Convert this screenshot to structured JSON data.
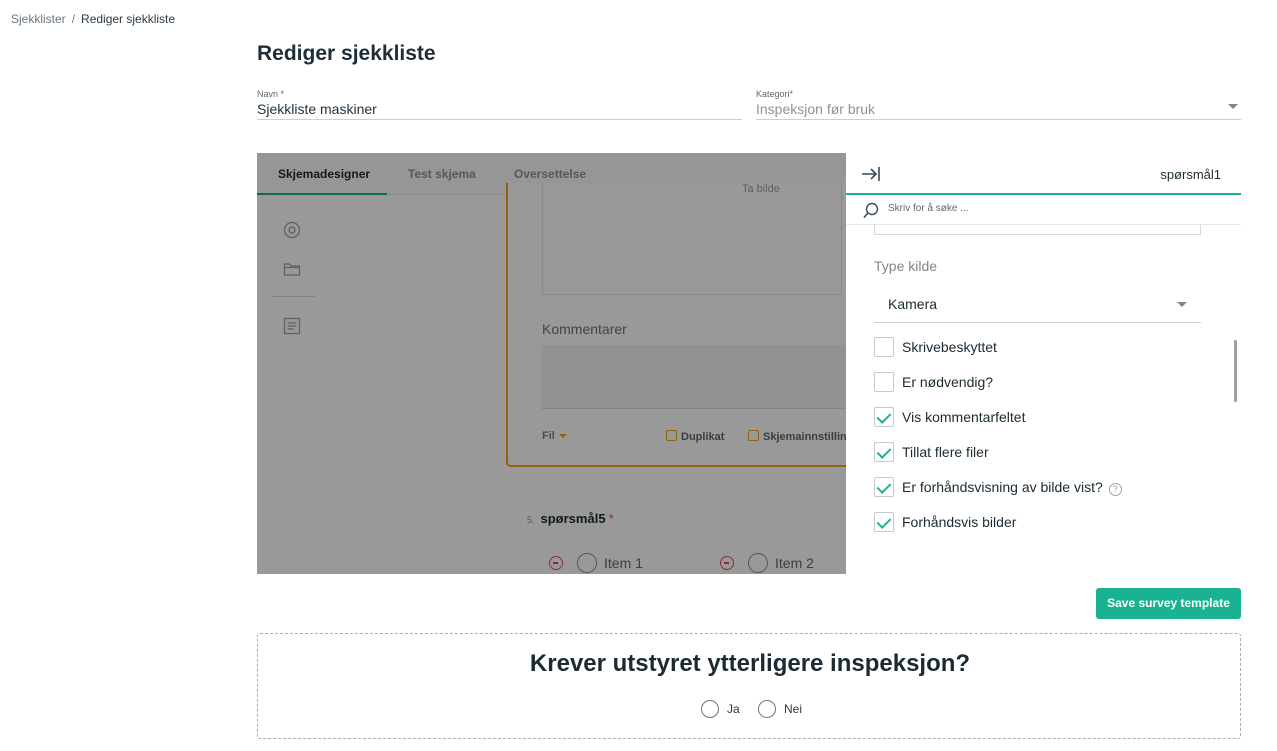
{
  "breadcrumb": {
    "root": "Sjekklister",
    "separator": "/",
    "current": "Rediger sjekkliste"
  },
  "page": {
    "title": "Rediger sjekkliste"
  },
  "form": {
    "name": {
      "label": "Navn",
      "required_mark": "*",
      "value": "Sjekkliste maskiner"
    },
    "category": {
      "label": "Kategori",
      "required_mark": "*",
      "value": "Inspeksjon før bruk"
    }
  },
  "designer": {
    "tabs": [
      {
        "label": "Skjemadesigner",
        "active": true
      },
      {
        "label": "Test skjema",
        "active": false
      },
      {
        "label": "Oversettelse",
        "active": false
      }
    ],
    "sidebar_icons": [
      "target-icon",
      "folder-icon",
      "list-icon"
    ],
    "question_card": {
      "take_photo_label": "Ta bilde",
      "comment_label": "Kommentarer",
      "type_label": "Fil",
      "actions": [
        "Duplikat",
        "Skjemainnstillinger"
      ]
    },
    "question5": {
      "number": "5.",
      "title": "spørsmål5",
      "required_mark": "*",
      "items": [
        "Item 1",
        "Item 2"
      ]
    }
  },
  "panel": {
    "selected": "spørsmål1",
    "search_placeholder": "Skriv for å søke ...",
    "source_type_label": "Type kilde",
    "source_type_value": "Kamera",
    "checkboxes": [
      {
        "label": "Skrivebeskyttet",
        "checked": false
      },
      {
        "label": "Er nødvendig?",
        "checked": false
      },
      {
        "label": "Vis kommentarfeltet",
        "checked": true
      },
      {
        "label": "Tillat flere filer",
        "checked": true
      },
      {
        "label": "Er forhåndsvisning av bilde vist?",
        "checked": true,
        "help": "?"
      },
      {
        "label": "Forhåndsvis bilder",
        "checked": true
      }
    ]
  },
  "actions": {
    "save_label": "Save survey template"
  },
  "preview": {
    "question": "Krever utstyret ytterligere inspeksjon?",
    "options": [
      "Ja",
      "Nei"
    ]
  },
  "colors": {
    "accent": "#19b394",
    "warning": "#f3a712",
    "danger": "#e5495b"
  }
}
